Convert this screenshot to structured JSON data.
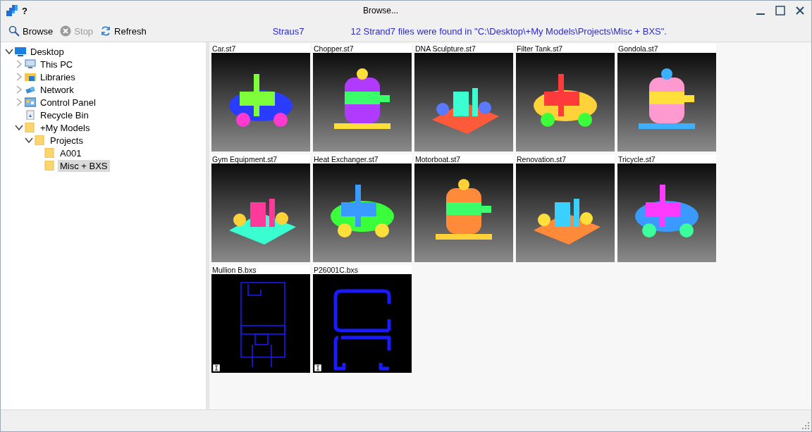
{
  "window": {
    "title": "Browse...",
    "app_mark": "?"
  },
  "toolbar": [
    {
      "kind": "browse",
      "label": "Browse",
      "disabled": false
    },
    {
      "kind": "stop",
      "label": "Stop",
      "disabled": true
    },
    {
      "kind": "refresh",
      "label": "Refresh",
      "disabled": false
    }
  ],
  "program": "Straus7",
  "message": "12 Strand7 files were found in \"C:\\Desktop\\+My Models\\Projects\\Misc + BXS\".",
  "tree": [
    {
      "label": "Desktop",
      "kind": "desktop",
      "expanded": true,
      "selected": false,
      "children": [
        {
          "label": "This PC",
          "kind": "pc",
          "expanded": false,
          "selected": false
        },
        {
          "label": "Libraries",
          "kind": "library",
          "expanded": false,
          "selected": false
        },
        {
          "label": "Network",
          "kind": "network",
          "expanded": false,
          "selected": false
        },
        {
          "label": "Control Panel",
          "kind": "control",
          "expanded": false,
          "selected": false
        },
        {
          "label": "Recycle Bin",
          "kind": "recycle",
          "selected": false
        },
        {
          "label": "+My Models",
          "kind": "folder",
          "expanded": true,
          "selected": false,
          "children": [
            {
              "label": "Projects",
              "kind": "folder",
              "expanded": true,
              "selected": false,
              "children": [
                {
                  "label": "A001",
                  "kind": "folder",
                  "selected": false
                },
                {
                  "label": "Misc + BXS",
                  "kind": "folder",
                  "selected": true
                }
              ]
            }
          ]
        }
      ]
    }
  ],
  "files": [
    {
      "name": "Car.st7",
      "kind": "model"
    },
    {
      "name": "Chopper.st7",
      "kind": "model"
    },
    {
      "name": "DNA Sculpture.st7",
      "kind": "model"
    },
    {
      "name": "Filter Tank.st7",
      "kind": "model"
    },
    {
      "name": "Gondola.st7",
      "kind": "model"
    },
    {
      "name": "Gym Equipment.st7",
      "kind": "model"
    },
    {
      "name": "Heat Exchanger.st7",
      "kind": "model"
    },
    {
      "name": "Motorboat.st7",
      "kind": "model"
    },
    {
      "name": "Renovation.st7",
      "kind": "model"
    },
    {
      "name": "Tricycle.st7",
      "kind": "model"
    },
    {
      "name": "Mullion B.bxs",
      "kind": "section"
    },
    {
      "name": "P26001C.bxs",
      "kind": "section"
    }
  ]
}
